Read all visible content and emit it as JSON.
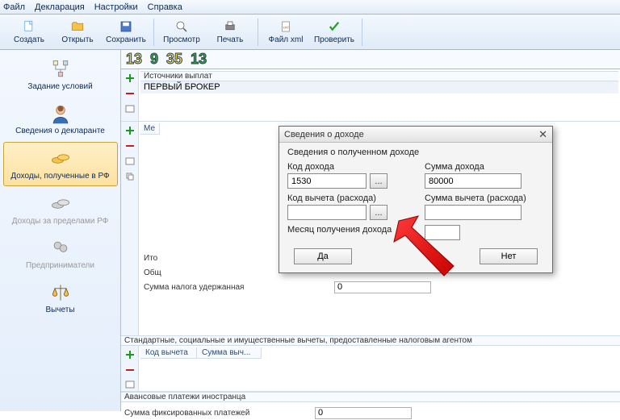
{
  "menu": {
    "file": "Файл",
    "decl": "Декларация",
    "settings": "Настройки",
    "help": "Справка"
  },
  "toolbar": {
    "create": "Создать",
    "open": "Открыть",
    "save": "Сохранить",
    "preview": "Просмотр",
    "print": "Печать",
    "xml": "Файл xml",
    "check": "Проверить"
  },
  "nav": {
    "conditions": "Задание условий",
    "declarant": "Сведения о декларанте",
    "income_rf": "Доходы, полученные в РФ",
    "income_abroad": "Доходы за пределами РФ",
    "entrepreneur": "Предприниматели",
    "deductions": "Вычеты"
  },
  "nums": {
    "a": "13",
    "b": "9",
    "c": "35",
    "d": "13"
  },
  "sources": {
    "header": "Источники выплат",
    "row": "ПЕРВЫЙ БРОКЕР"
  },
  "months": {
    "col_month": "Ме"
  },
  "itogo": {
    "title": "Ито",
    "total": "Общ",
    "withheld": "Сумма налога удержанная",
    "withheld_val": "0"
  },
  "ded": {
    "header": "Стандартные, социальные и имущественные вычеты, предоставленные налоговым агентом",
    "col_code": "Код вычета",
    "col_sum": "Сумма выч..."
  },
  "adv": {
    "header": "Авансовые платежи иностранца",
    "label": "Сумма фиксированных платежей",
    "value": "0"
  },
  "dialog": {
    "title": "Сведения о доходе",
    "sub": "Сведения о полученном доходе",
    "code_label": "Код дохода",
    "code_val": "1530",
    "sum_label": "Сумма дохода",
    "sum_val": "80000",
    "ded_code_label": "Код вычета (расхода)",
    "ded_sum_label": "Сумма вычета (расхода)",
    "month_label": "Месяц получения дохода",
    "yes": "Да",
    "no": "Нет"
  }
}
